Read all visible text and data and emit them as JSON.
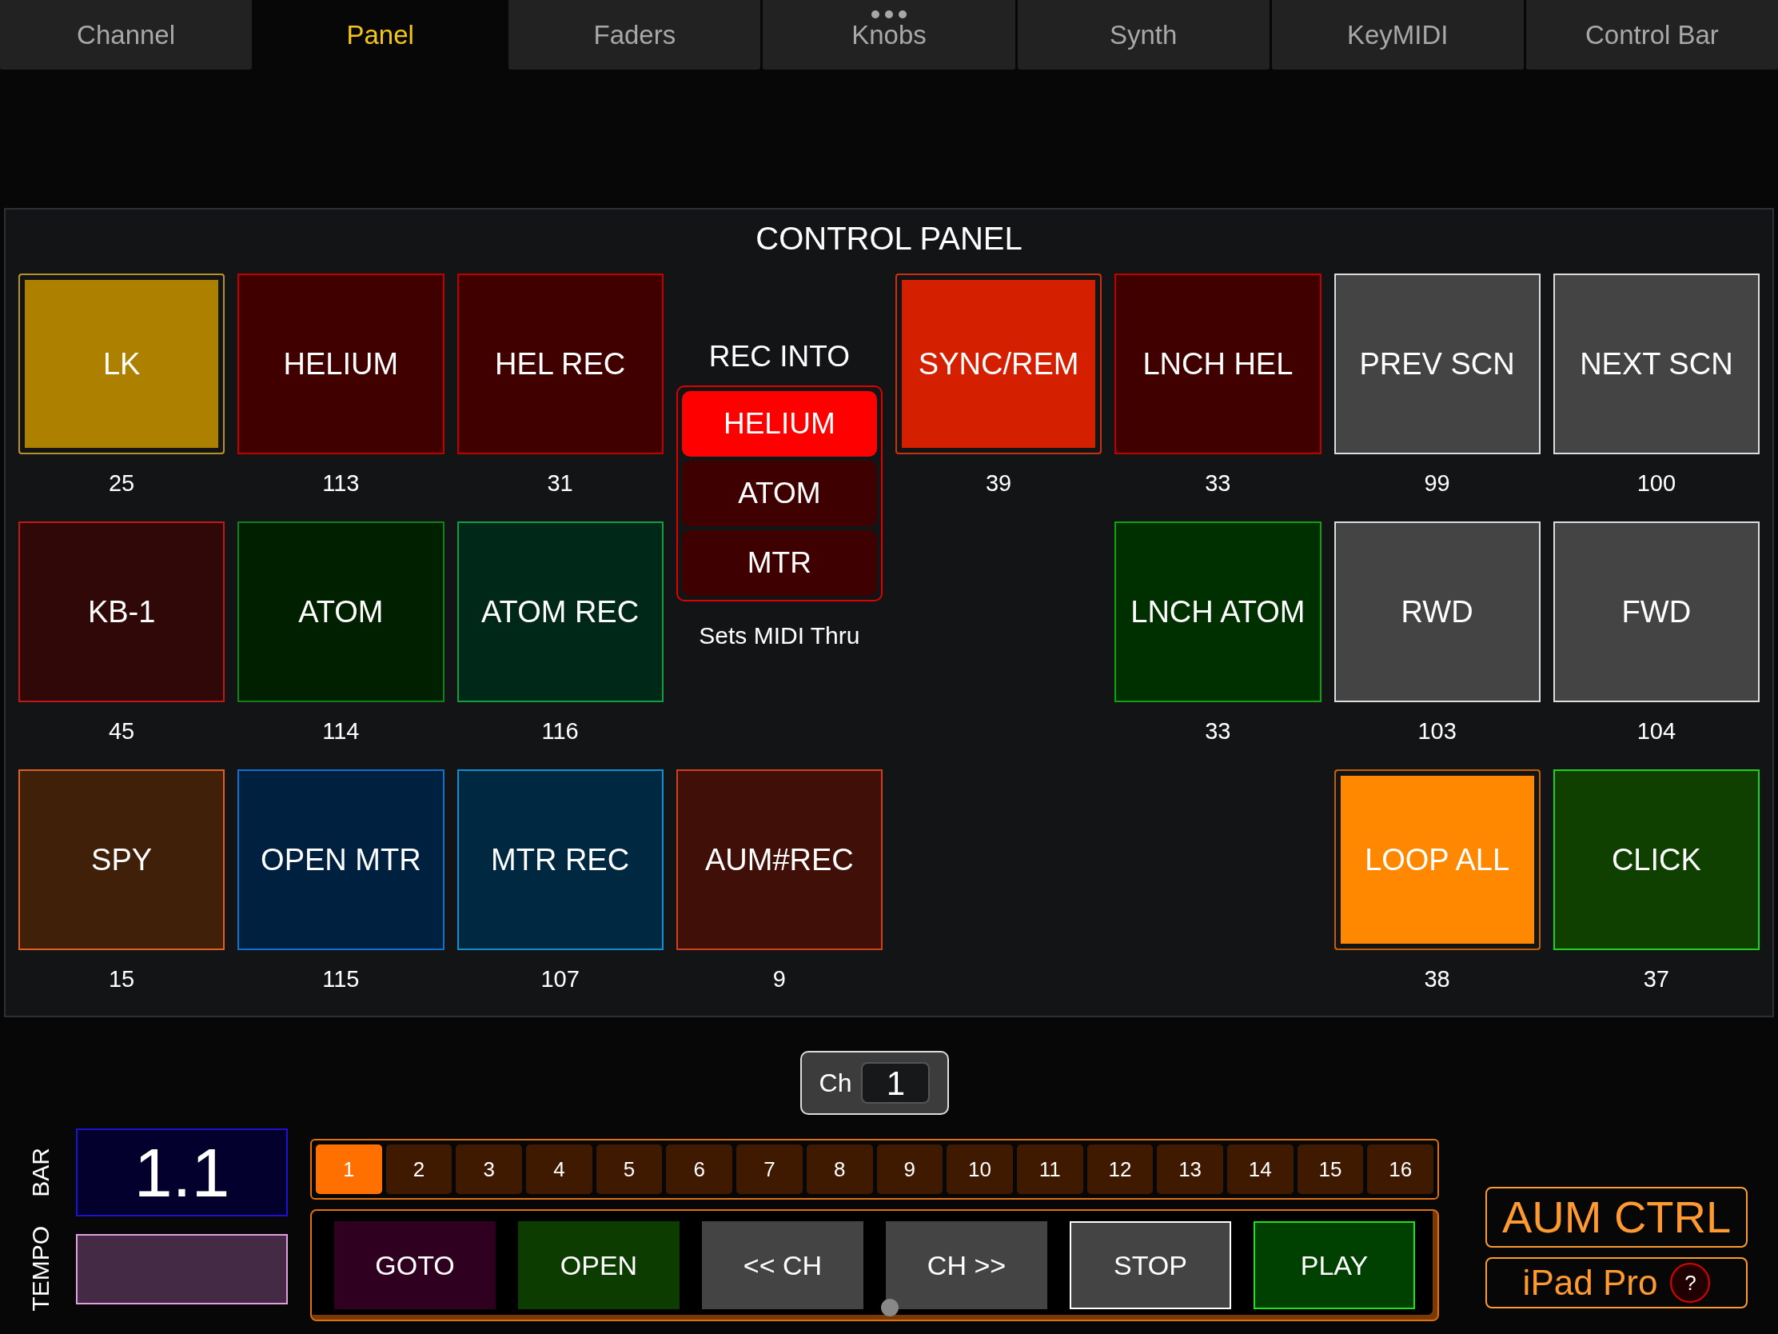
{
  "tabs": [
    {
      "label": "Channel",
      "selected": false,
      "has_menu": false
    },
    {
      "label": "Panel",
      "selected": true,
      "has_menu": false
    },
    {
      "label": "Faders",
      "selected": false,
      "has_menu": false
    },
    {
      "label": "Knobs",
      "selected": false,
      "has_menu": true
    },
    {
      "label": "Synth",
      "selected": false,
      "has_menu": false
    },
    {
      "label": "KeyMIDI",
      "selected": false,
      "has_menu": false
    },
    {
      "label": "Control Bar",
      "selected": false,
      "has_menu": false
    }
  ],
  "panel": {
    "title": "CONTROL PANEL",
    "rows": [
      [
        {
          "kind": "pad",
          "label": "LK",
          "number": "25",
          "color": "#ad8000",
          "frame": {
            "color": "#b89028"
          },
          "on": true
        },
        {
          "kind": "pad",
          "label": "HELIUM",
          "number": "113",
          "color": "#400000",
          "frame": {
            "color": "#c00000"
          },
          "on": false
        },
        {
          "kind": "pad",
          "label": "HEL REC",
          "number": "31",
          "color": "#400000",
          "frame": {
            "color": "#c00000"
          },
          "on": false
        },
        {
          "kind": "selector",
          "title": "REC INTO",
          "note": "Sets MIDI Thru",
          "options": [
            {
              "label": "HELIUM",
              "selected": true
            },
            {
              "label": "ATOM",
              "selected": false
            },
            {
              "label": "MTR",
              "selected": false
            }
          ]
        },
        {
          "kind": "pad",
          "label": "SYNC/REM",
          "number": "39",
          "color": "#d42000",
          "frame": {
            "color": "#c83010"
          },
          "on": true
        },
        {
          "kind": "pad",
          "label": "LNCH HEL",
          "number": "33",
          "color": "#400000",
          "frame": {
            "color": "#c00000"
          },
          "on": false
        },
        {
          "kind": "pad",
          "label": "PREV SCN",
          "number": "99",
          "color": "#444444",
          "frame": {
            "color": "#dddddd"
          },
          "on": false
        },
        {
          "kind": "pad",
          "label": "NEXT SCN",
          "number": "100",
          "color": "#444444",
          "frame": {
            "color": "#dddddd"
          },
          "on": false
        }
      ],
      [
        {
          "kind": "pad",
          "label": "KB-1",
          "number": "45",
          "color": "#300808",
          "frame": {
            "color": "#c01818"
          },
          "on": false
        },
        {
          "kind": "pad",
          "label": "ATOM",
          "number": "114",
          "color": "#002000",
          "frame": {
            "color": "#108018"
          },
          "on": false
        },
        {
          "kind": "pad",
          "label": "ATOM REC",
          "number": "116",
          "color": "#002818",
          "frame": {
            "color": "#10a040"
          },
          "on": false
        },
        "",
        "",
        {
          "kind": "pad",
          "label": "LNCH ATOM",
          "number": "33",
          "color": "#003000",
          "frame": {
            "color": "#10a010"
          },
          "on": false
        },
        {
          "kind": "pad",
          "label": "RWD",
          "number": "103",
          "color": "#444444",
          "frame": {
            "color": "#dddddd"
          },
          "on": false
        },
        {
          "kind": "pad",
          "label": "FWD",
          "number": "104",
          "color": "#444444",
          "frame": {
            "color": "#dddddd"
          },
          "on": false
        }
      ],
      [
        {
          "kind": "pad",
          "label": "SPY",
          "number": "15",
          "color": "#402008",
          "frame": {
            "color": "#e06020"
          },
          "on": false
        },
        {
          "kind": "pad",
          "label": "OPEN MTR",
          "number": "115",
          "color": "#002040",
          "frame": {
            "color": "#1070d0"
          },
          "on": false
        },
        {
          "kind": "pad",
          "label": "MTR REC",
          "number": "107",
          "color": "#002840",
          "frame": {
            "color": "#1090d0"
          },
          "on": false
        },
        {
          "kind": "pad",
          "label": "AUM#REC",
          "number": "9",
          "color": "#401008",
          "frame": {
            "color": "#d04020"
          },
          "on": false
        },
        "",
        "",
        {
          "kind": "pad",
          "label": "LOOP ALL",
          "number": "38",
          "color": "#ff8800",
          "frame": {
            "color": "#c06000"
          },
          "on": true
        },
        {
          "kind": "pad",
          "label": "CLICK",
          "number": "37",
          "color": "#104000",
          "frame": {
            "color": "#20d020"
          },
          "on": false
        }
      ]
    ]
  },
  "channel_select": {
    "label": "Ch",
    "value": "1"
  },
  "bar": {
    "label": "BAR",
    "value": "1.1"
  },
  "tempo": {
    "label": "TEMPO"
  },
  "channels": [
    {
      "label": "1",
      "selected": true
    },
    {
      "label": "2",
      "selected": false
    },
    {
      "label": "3",
      "selected": false
    },
    {
      "label": "4",
      "selected": false
    },
    {
      "label": "5",
      "selected": false
    },
    {
      "label": "6",
      "selected": false
    },
    {
      "label": "7",
      "selected": false
    },
    {
      "label": "8",
      "selected": false
    },
    {
      "label": "9",
      "selected": false
    },
    {
      "label": "10",
      "selected": false
    },
    {
      "label": "11",
      "selected": false
    },
    {
      "label": "12",
      "selected": false
    },
    {
      "label": "13",
      "selected": false
    },
    {
      "label": "14",
      "selected": false
    },
    {
      "label": "15",
      "selected": false
    },
    {
      "label": "16",
      "selected": false
    }
  ],
  "transport": [
    {
      "label": "GOTO",
      "color": "#300020",
      "frame": {
        "color": "#300020"
      }
    },
    {
      "label": "OPEN",
      "color": "#0c3c00",
      "frame": {
        "color": "#0c3c00"
      }
    },
    {
      "label": "<< CH",
      "color": "#444444",
      "frame": {
        "color": "#444444"
      }
    },
    {
      "label": "CH >>",
      "color": "#444444",
      "frame": {
        "color": "#444444"
      }
    },
    {
      "label": "STOP",
      "color": "#444444",
      "frame": {
        "color": "#ffffff"
      }
    },
    {
      "label": "PLAY",
      "color": "#004000",
      "frame": {
        "color": "#20e020"
      }
    }
  ],
  "brand": {
    "title": "AUM CTRL",
    "subtitle": "iPad Pro",
    "help": "?"
  }
}
